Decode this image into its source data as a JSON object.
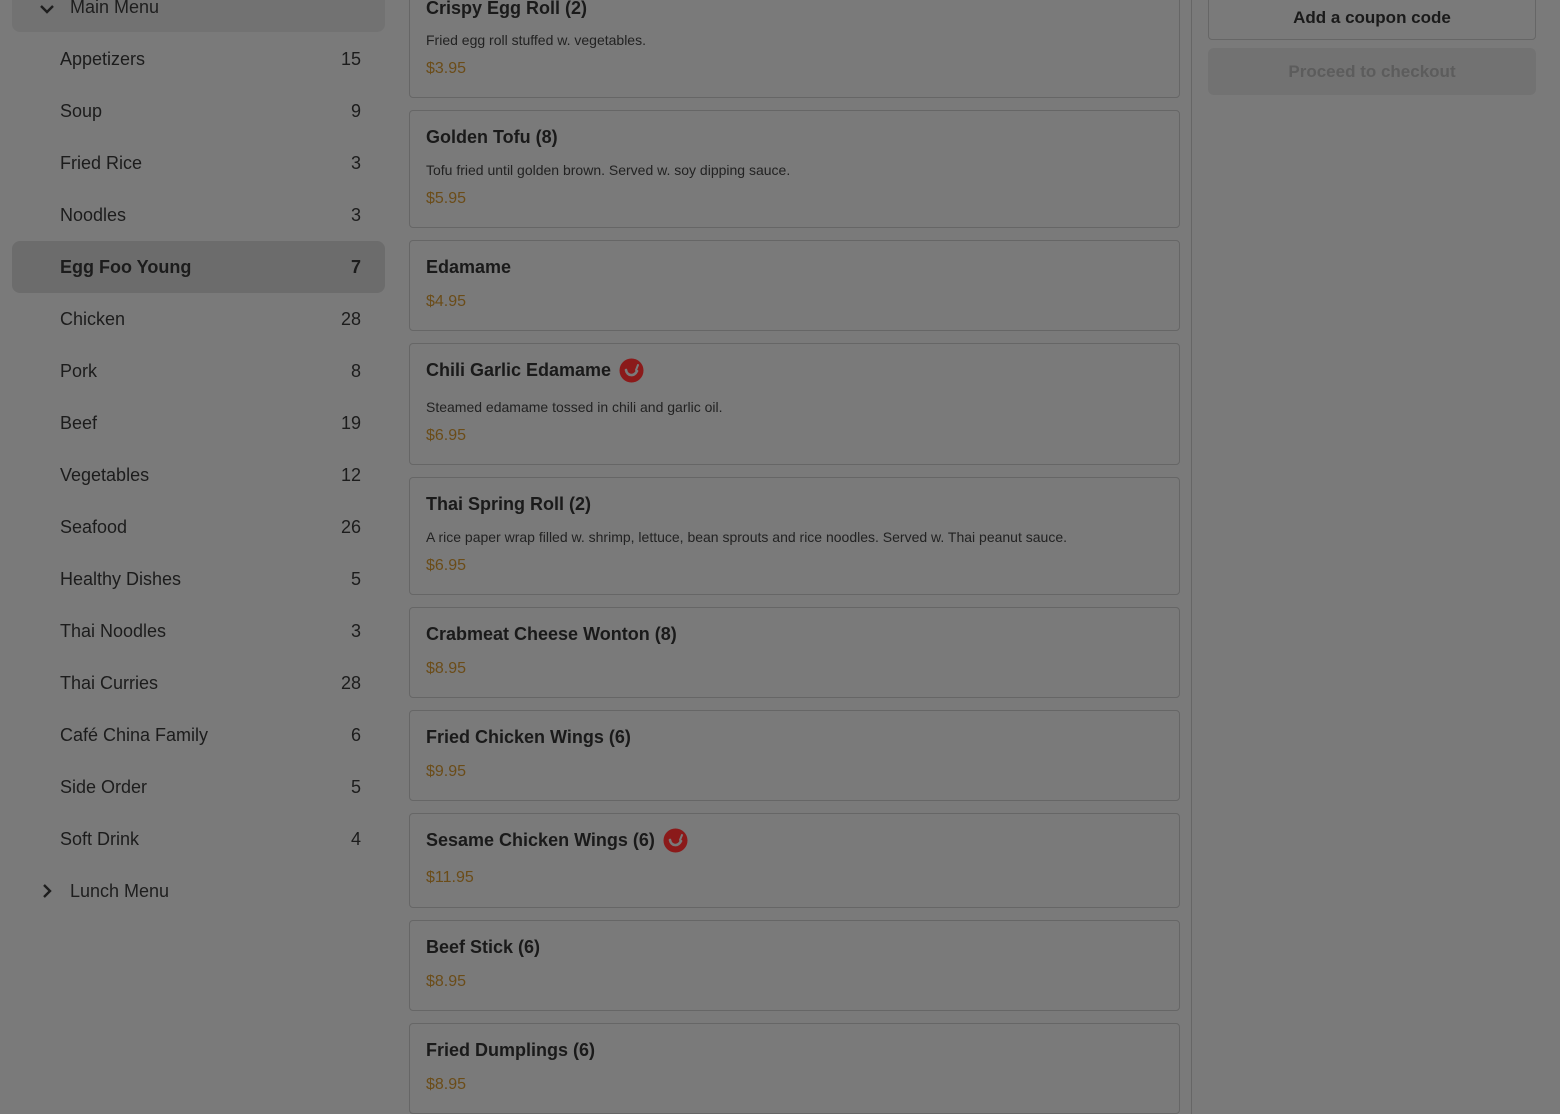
{
  "sidebar": {
    "main_menu_label": "Main Menu",
    "lunch_menu_label": "Lunch Menu",
    "categories": [
      {
        "label": "Appetizers",
        "count": "15"
      },
      {
        "label": "Soup",
        "count": "9"
      },
      {
        "label": "Fried Rice",
        "count": "3"
      },
      {
        "label": "Noodles",
        "count": "3"
      },
      {
        "label": "Egg Foo Young",
        "count": "7"
      },
      {
        "label": "Chicken",
        "count": "28"
      },
      {
        "label": "Pork",
        "count": "8"
      },
      {
        "label": "Beef",
        "count": "19"
      },
      {
        "label": "Vegetables",
        "count": "12"
      },
      {
        "label": "Seafood",
        "count": "26"
      },
      {
        "label": "Healthy Dishes",
        "count": "5"
      },
      {
        "label": "Thai Noodles",
        "count": "3"
      },
      {
        "label": "Thai Curries",
        "count": "28"
      },
      {
        "label": "Café China Family",
        "count": "6"
      },
      {
        "label": "Side Order",
        "count": "5"
      },
      {
        "label": "Soft Drink",
        "count": "4"
      }
    ],
    "active_category": "Egg Foo Young"
  },
  "items": [
    {
      "name": "Crispy Egg Roll (2)",
      "description": "Fried egg roll stuffed w. vegetables.",
      "price": "$3.95",
      "spicy": false
    },
    {
      "name": "Golden Tofu (8)",
      "description": "Tofu fried until golden brown. Served w. soy dipping sauce.",
      "price": "$5.95",
      "spicy": false
    },
    {
      "name": "Edamame",
      "description": "",
      "price": "$4.95",
      "spicy": false
    },
    {
      "name": "Chili Garlic Edamame",
      "description": "Steamed edamame tossed in chili and garlic oil.",
      "price": "$6.95",
      "spicy": true
    },
    {
      "name": "Thai Spring Roll (2)",
      "description": "A rice paper wrap filled w. shrimp, lettuce, bean sprouts and rice noodles. Served w. Thai peanut sauce.",
      "price": "$6.95",
      "spicy": false
    },
    {
      "name": "Crabmeat Cheese Wonton (8)",
      "description": "",
      "price": "$8.95",
      "spicy": false
    },
    {
      "name": "Fried Chicken Wings (6)",
      "description": "",
      "price": "$9.95",
      "spicy": false
    },
    {
      "name": "Sesame Chicken Wings (6)",
      "description": "",
      "price": "$11.95",
      "spicy": true
    },
    {
      "name": "Beef Stick (6)",
      "description": "",
      "price": "$8.95",
      "spicy": false
    },
    {
      "name": "Fried Dumplings (6)",
      "description": "",
      "price": "$8.95",
      "spicy": false
    }
  ],
  "cart": {
    "coupon_label": "Add a coupon code",
    "checkout_label": "Proceed to checkout"
  },
  "icons": {
    "spicy": "chili-pepper-icon",
    "expand": "chevron-down-icon",
    "collapse": "chevron-right-icon"
  },
  "colors": {
    "price": "#6b4c18",
    "spicy_badge": "#8b1a1a"
  }
}
